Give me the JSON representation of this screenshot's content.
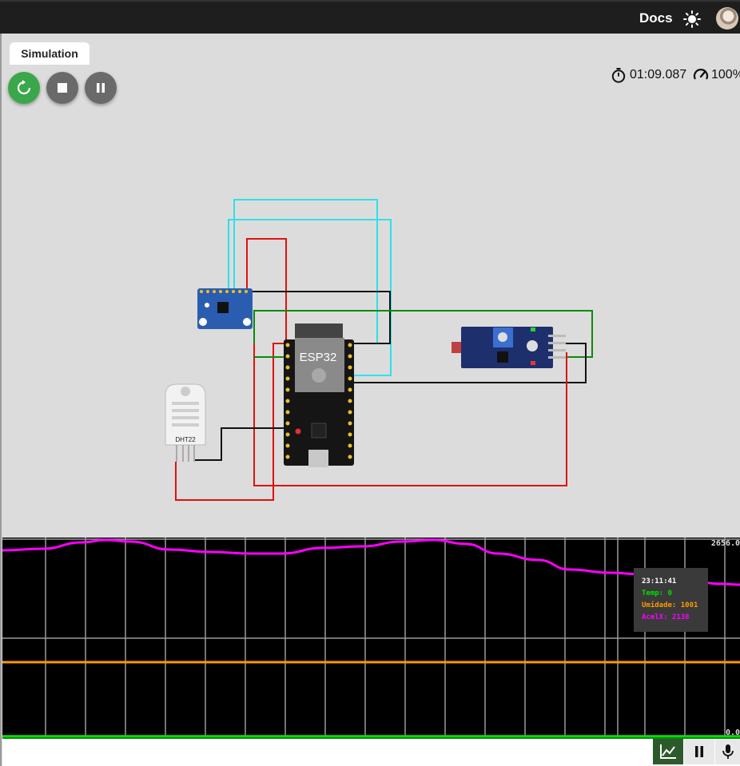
{
  "header": {
    "docs_label": "Docs",
    "theme_icon": "sun-icon",
    "avatar": "user-avatar"
  },
  "simulation": {
    "tab_label": "Simulation",
    "controls": {
      "restart": "restart-icon",
      "stop": "stop-icon",
      "pause": "pause-icon"
    },
    "timer": "01:09.087",
    "speed": "100%"
  },
  "parts": {
    "esp32_label": "ESP32",
    "dht22_label": "DHT22"
  },
  "plotter": {
    "y_max": "2656.0",
    "y_min": "0.0",
    "colors": {
      "temp": "#00e000",
      "umidade": "#ff9900",
      "acelx": "#ff00ff"
    },
    "tooltip": {
      "time": "23:11:41",
      "temp": "Temp: 0",
      "umidade": "Umidade: 1001",
      "acelx": "AcelX: 2138"
    }
  },
  "serial": {
    "input_value": ""
  }
}
